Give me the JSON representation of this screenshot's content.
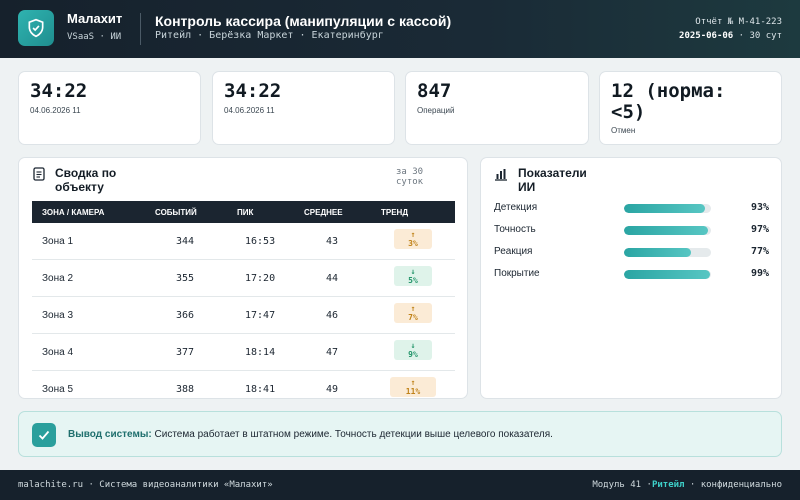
{
  "header": {
    "brand": "Малахит",
    "brand_sub": "VSaaS · ИИ",
    "title": "Контроль кассира (манипуляции с кассой)",
    "subtitle": "Ритейл · Берёзка Маркет · Екатеринбург",
    "report_id": "Отчёт № М-41-223",
    "report_date": "2025-06-06",
    "report_period": "· 30 сут",
    "logo_icon": "shield-check-icon"
  },
  "kpis": [
    {
      "value": "34:22",
      "label": "04.06.2026 11"
    },
    {
      "value": "34:22",
      "label": "04.06.2026 11"
    },
    {
      "value": "847",
      "label": "Операций"
    },
    {
      "value": "12 (норма: <5)",
      "label": "Отмен"
    }
  ],
  "summary_panel": {
    "title": "Сводка по объекту",
    "meta": "за 30 суток",
    "icon": "document-icon",
    "columns": [
      "ЗОНА / КАМЕРА",
      "СОБЫТИЙ",
      "ПИК",
      "СРЕДНЕЕ",
      "ТРЕНД"
    ],
    "rows": [
      {
        "zone": "Зона 1",
        "events": "344",
        "peak": "16:53",
        "avg": "43",
        "trend_arrow": "↑",
        "trend_pct": "3%",
        "trend_dir": "up"
      },
      {
        "zone": "Зона 2",
        "events": "355",
        "peak": "17:20",
        "avg": "44",
        "trend_arrow": "↓",
        "trend_pct": "5%",
        "trend_dir": "down"
      },
      {
        "zone": "Зона 3",
        "events": "366",
        "peak": "17:47",
        "avg": "46",
        "trend_arrow": "↑",
        "trend_pct": "7%",
        "trend_dir": "up"
      },
      {
        "zone": "Зона 4",
        "events": "377",
        "peak": "18:14",
        "avg": "47",
        "trend_arrow": "↓",
        "trend_pct": "9%",
        "trend_dir": "down"
      },
      {
        "zone": "Зона 5",
        "events": "388",
        "peak": "18:41",
        "avg": "49",
        "trend_arrow": "↑",
        "trend_pct": "11%",
        "trend_dir": "up"
      }
    ]
  },
  "ai_panel": {
    "title": "Показатели ИИ",
    "icon": "bar-chart-icon",
    "metrics": [
      {
        "label": "Детекция",
        "value": 93,
        "pct": "93%"
      },
      {
        "label": "Точность",
        "value": 97,
        "pct": "97%"
      },
      {
        "label": "Реакция",
        "value": 77,
        "pct": "77%"
      },
      {
        "label": "Покрытие",
        "value": 99,
        "pct": "99%"
      }
    ]
  },
  "conclusion": {
    "label": "Вывод системы:",
    "text": "Система работает в штатном режиме. Точность детекции выше целевого показателя.",
    "icon": "check-icon"
  },
  "footer": {
    "left": "malachite.ru · Система видеоаналитики «Малахит»",
    "module": "Модуль 41 ·",
    "accent": "Ритейл",
    "right": "· конфиденциально"
  },
  "colors": {
    "accent": "#2aa5a3",
    "dark": "#1b2530",
    "trend_up": "#c08219",
    "trend_down": "#23956a"
  }
}
